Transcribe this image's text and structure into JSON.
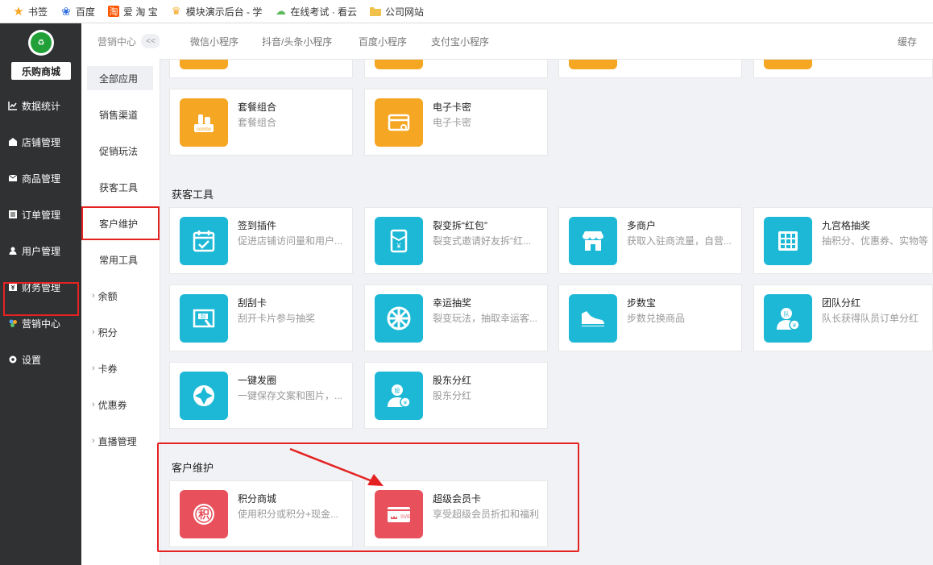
{
  "bookmarks": [
    {
      "label": "书签",
      "icon": "star-icon",
      "color": "#f5a623"
    },
    {
      "label": "百度",
      "icon": "baidu-paw-icon",
      "color": "#2f6fe0"
    },
    {
      "label": "爱 淘 宝",
      "icon": "taobao-icon",
      "color": "#ff5500"
    },
    {
      "label": "模块演示后台 - 学",
      "icon": "trophy-icon",
      "color": "#f5a623"
    },
    {
      "label": "在线考试 · 看云",
      "icon": "cloud-icon",
      "color": "#5cb85c"
    },
    {
      "label": "公司网站",
      "icon": "folder-icon",
      "color": "#f0c24b"
    }
  ],
  "sidebar": {
    "shop_name": "乐购商城",
    "logo_icon": "shop-logo-icon",
    "items": [
      {
        "label": "数据统计",
        "icon": "chart-icon"
      },
      {
        "label": "店铺管理",
        "icon": "store-icon"
      },
      {
        "label": "商品管理",
        "icon": "mail-icon"
      },
      {
        "label": "订单管理",
        "icon": "list-icon"
      },
      {
        "label": "用户管理",
        "icon": "user-icon"
      },
      {
        "label": "财务管理",
        "icon": "finance-icon"
      },
      {
        "label": "营销中心",
        "icon": "marketing-icon"
      },
      {
        "label": "设置",
        "icon": "gear-icon"
      }
    ],
    "active": "营销中心"
  },
  "nav2": {
    "title": "营销中心",
    "collapse_label": "<<",
    "items": [
      {
        "label": "全部应用"
      },
      {
        "label": "销售渠道"
      },
      {
        "label": "促销玩法"
      },
      {
        "label": "获客工具"
      },
      {
        "label": "客户维护"
      },
      {
        "label": "常用工具"
      },
      {
        "label": "余额"
      },
      {
        "label": "积分"
      },
      {
        "label": "卡券"
      },
      {
        "label": "优惠券"
      },
      {
        "label": "直播管理"
      }
    ],
    "selected": "全部应用",
    "highlighted": "客户维护"
  },
  "tabs": [
    "微信小程序",
    "抖音/头条小程序",
    "百度小程序",
    "支付宝小程序"
  ],
  "cache_label": "缓存",
  "promo_cards": [
    {
      "title": "套餐组合",
      "desc": "套餐组合",
      "icon": "combo-icon",
      "color": "#f5a623"
    },
    {
      "title": "电子卡密",
      "desc": "电子卡密",
      "icon": "card-key-icon",
      "color": "#f5a623"
    }
  ],
  "sections": {
    "acquisition": {
      "title": "获客工具",
      "cards": [
        {
          "title": "签到插件",
          "desc": "促进店铺访问量和用户...",
          "icon": "calendar-check-icon",
          "color": "#1cb8d6"
        },
        {
          "title": "裂变拆“红包”",
          "desc": "裂变式邀请好友拆“红...",
          "icon": "red-envelope-icon",
          "color": "#1cb8d6"
        },
        {
          "title": "多商户",
          "desc": "获取入驻商流量，自营...",
          "icon": "storefront-icon",
          "color": "#1cb8d6"
        },
        {
          "title": "九宫格抽奖",
          "desc": "抽积分、优惠券、实物等",
          "icon": "grid-icon",
          "color": "#1cb8d6"
        },
        {
          "title": "刮刮卡",
          "desc": "刮开卡片参与抽奖",
          "icon": "scratch-card-icon",
          "color": "#1cb8d6"
        },
        {
          "title": "幸运抽奖",
          "desc": "裂变玩法，抽取幸运客...",
          "icon": "wheel-icon",
          "color": "#1cb8d6"
        },
        {
          "title": "步数宝",
          "desc": "步数兑换商品",
          "icon": "sneaker-icon",
          "color": "#1cb8d6"
        },
        {
          "title": "团队分红",
          "desc": "队长获得队员订单分红",
          "icon": "team-bonus-icon",
          "color": "#1cb8d6"
        },
        {
          "title": "一键发圈",
          "desc": "一键保存文案和图片，...",
          "icon": "aperture-icon",
          "color": "#1cb8d6"
        },
        {
          "title": "股东分红",
          "desc": "股东分红",
          "icon": "shareholder-icon",
          "color": "#1cb8d6"
        }
      ]
    },
    "retention": {
      "title": "客户维护",
      "cards": [
        {
          "title": "积分商城",
          "desc": "使用积分或积分+现金...",
          "icon": "points-icon",
          "color": "#e8505b",
          "icon_text": "积"
        },
        {
          "title": "超级会员卡",
          "desc": "享受超级会员折扣和福利",
          "icon": "svip-card-icon",
          "color": "#e8505b",
          "icon_text": "SVIP"
        }
      ]
    }
  }
}
